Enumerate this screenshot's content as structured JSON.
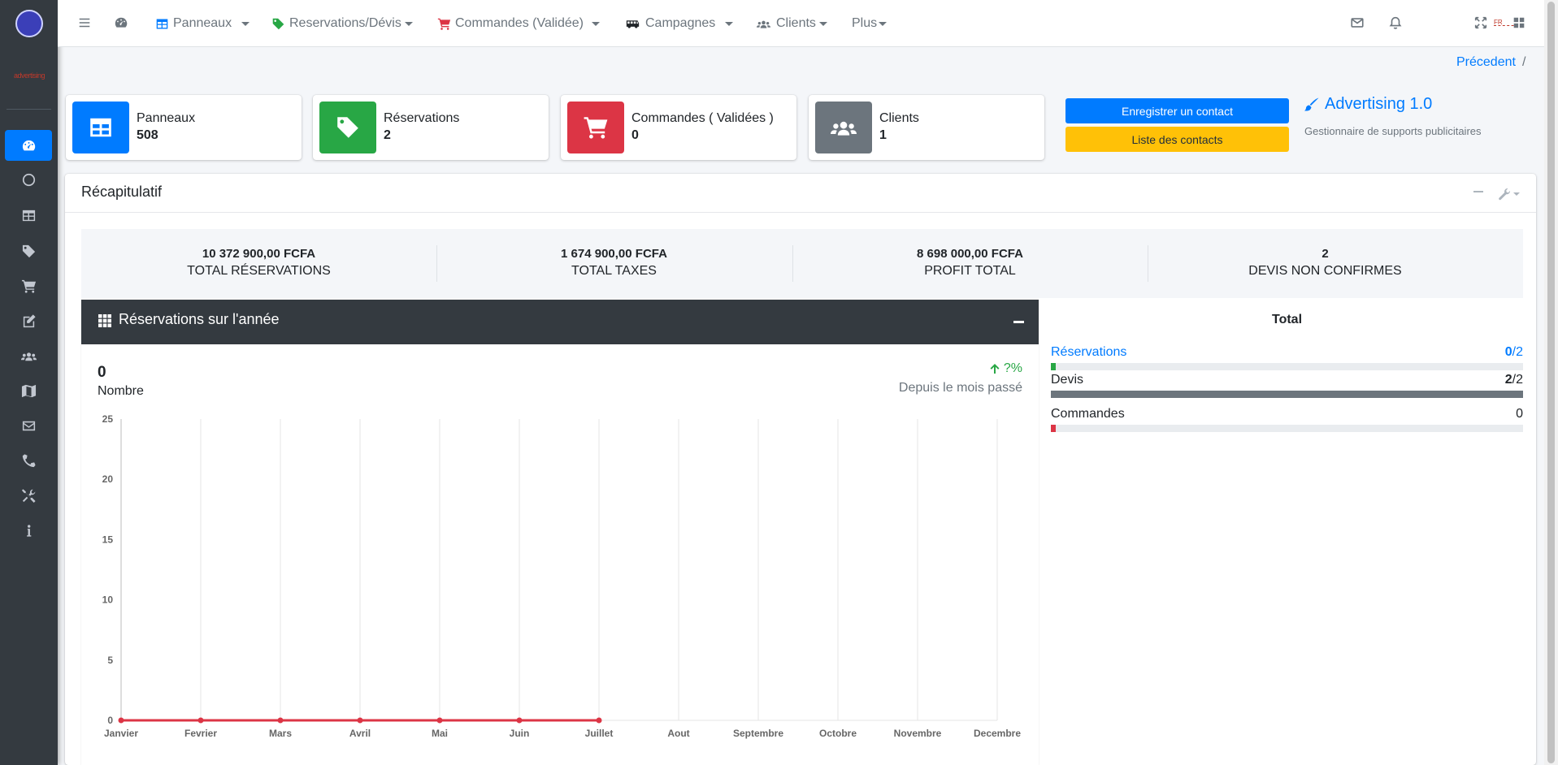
{
  "sidebar": {
    "logo_text": "Advertising",
    "brand_mark": "advertising",
    "items": [
      {
        "name": "tachometer-icon",
        "active": true
      },
      {
        "name": "circle-icon",
        "active": false
      },
      {
        "name": "table-icon",
        "active": false
      },
      {
        "name": "tag-icon",
        "active": false
      },
      {
        "name": "cart-icon",
        "active": false
      },
      {
        "name": "edit-icon",
        "active": false
      },
      {
        "name": "users-icon",
        "active": false
      },
      {
        "name": "map-icon",
        "active": false
      },
      {
        "name": "envelope-icon",
        "active": false
      },
      {
        "name": "phone-icon",
        "active": false
      },
      {
        "name": "tools-icon",
        "active": false
      },
      {
        "name": "info-icon",
        "active": false
      }
    ]
  },
  "topnav": {
    "panneaux": "Panneaux",
    "reservations": "Reservations/Dévis",
    "commandes": "Commandes (Validée)",
    "campagnes": "Campagnes",
    "clients": "Clients",
    "plus": "Plus",
    "flag_text": "FR"
  },
  "breadcrumb": {
    "previous": "Précedent",
    "separator": "/"
  },
  "info_boxes": [
    {
      "label": "Panneaux",
      "value": "508",
      "color": "#007bff"
    },
    {
      "label": "Réservations",
      "value": "2",
      "color": "#28a745"
    },
    {
      "label": "Commandes ( Validées )",
      "value": "0",
      "color": "#dc3545"
    },
    {
      "label": "Clients",
      "value": "1",
      "color": "#6c757d"
    }
  ],
  "actions": {
    "register": "Enregistrer un contact",
    "list": "Liste des contacts"
  },
  "brand": {
    "title": "Advertising 1.0",
    "subtitle": "Gestionnaire de supports publicitaires"
  },
  "recap": {
    "title": "Récapitulatif",
    "summary": [
      {
        "value": "10 372 900,00 FCFA",
        "label": "TOTAL RÉSERVATIONS"
      },
      {
        "value": "1 674 900,00 FCFA",
        "label": "TOTAL TAXES"
      },
      {
        "value": "8 698 000,00 FCFA",
        "label": "PROFIT TOTAL"
      },
      {
        "value": "2",
        "label": "DEVIS NON CONFIRMES"
      }
    ]
  },
  "chart_panel": {
    "title": "Réservations sur l'année",
    "stat_value": "0",
    "stat_label": "Nombre",
    "change": "?%",
    "since": "Depuis le mois passé"
  },
  "chart_data": {
    "type": "line",
    "categories": [
      "Janvier",
      "Fevrier",
      "Mars",
      "Avril",
      "Mai",
      "Juin",
      "Juillet",
      "Aout",
      "Septembre",
      "Octobre",
      "Novembre",
      "Decembre"
    ],
    "series": [
      {
        "values": [
          0,
          0,
          0,
          0,
          0,
          0,
          0
        ],
        "color": "#dc3545"
      }
    ],
    "yticks": [
      "0",
      "5",
      "10",
      "15",
      "20",
      "25"
    ],
    "ylim": [
      0,
      25
    ],
    "grid": "vertical"
  },
  "totals": {
    "title": "Total",
    "rows": [
      {
        "label": "Réservations",
        "current": "0",
        "sep": "/",
        "total": "2",
        "fraction": 0.01,
        "color": "#28a745",
        "link": true
      },
      {
        "label": "Devis",
        "current": "2",
        "sep": "/",
        "total": "2",
        "fraction": 1.0,
        "color": "#6c757d",
        "link": false
      },
      {
        "label": "Commandes",
        "current": "0",
        "sep": "",
        "total": "",
        "fraction": 0.01,
        "color": "#dc3545",
        "link": false
      }
    ]
  }
}
